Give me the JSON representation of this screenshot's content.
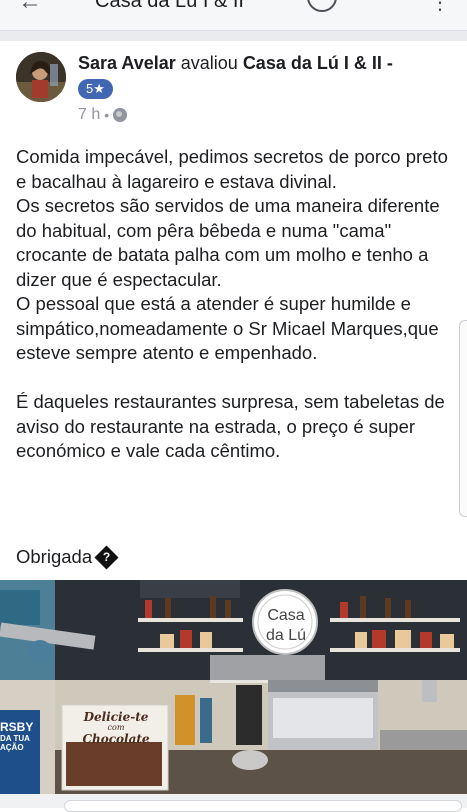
{
  "topbar": {
    "back_glyph": "←",
    "title": "Casa da Lú I & II",
    "more_glyph": "⋮",
    "search_icon": "search-icon"
  },
  "post": {
    "author": "Sara Avelar",
    "verb": "avaliou",
    "page": "Casa da Lú I & II -",
    "rating": "5★",
    "time": "7 h",
    "time_sep": "•",
    "privacy_icon": "globe-icon",
    "paragraphs": [
      "Comida impecável, pedimos secretos de porco preto e bacalhau à lagareiro e estava divinal.",
      "Os secretos são servidos de uma maneira diferente do habitual, com pêra bêbeda e numa \"cama\" crocante de batata palha com um molho e tenho a dizer que é espectacular.",
      "O pessoal que está a atender é super humilde e simpático,nomeadamente o Sr Micael Marques,que esteve sempre atento e empenhado.",
      "É daqueles restaurantes surpresa, sem tabeletas de aviso do restaurante na estrada, o preço é super económico e vale cada cêntimo."
    ],
    "closing": "Obrigada",
    "closing_glyph": "?"
  },
  "photo": {
    "logo_line1": "Casa",
    "logo_line2": "da Lú",
    "sign_line1": "Delicie-te",
    "sign_line2": "com",
    "sign_line3": "Chocolate",
    "banner_line1": "RSBY",
    "banner_line2": "DA TUA",
    "banner_line3": "AÇÃO"
  },
  "colors": {
    "badge": "#4267b2",
    "meta": "#90949c",
    "text": "#1c1e21"
  }
}
